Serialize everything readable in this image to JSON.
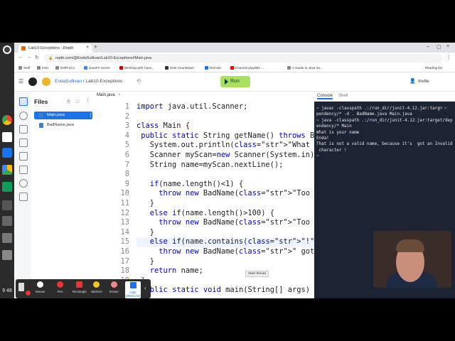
{
  "browser": {
    "tab_title": "Lab10-Exceptions - Replit",
    "url": "replit.com/@EndaSullivan/Lab10-Exceptions#Main.java",
    "bookmarks": [
      "Stuff",
      "KSU",
      "DefProCo",
      "JavaFX Scene",
      "Working with Canv...",
      "Dots Countdown",
      "Remote",
      "Channel playlists -...",
      "A Guide to Java So..."
    ],
    "reading_list": "Reading list"
  },
  "replit": {
    "user": "EndaSullivan",
    "repl": "Lab10-Exceptions",
    "run_label": "Run",
    "invite_label": "Invite"
  },
  "files": {
    "title": "Files",
    "items": [
      "Main.java",
      "BadName.java"
    ]
  },
  "editor": {
    "tab": "Main.java",
    "tooltip": "Start thread",
    "lines": [
      {
        "n": "1",
        "code": "import java.util.Scanner;"
      },
      {
        "n": "2",
        "code": ""
      },
      {
        "n": "3",
        "code": "class Main {"
      },
      {
        "n": "4",
        "code": " public static String getName() throws Ba"
      },
      {
        "n": "5",
        "code": "   System.out.println(\"What is your name"
      },
      {
        "n": "6",
        "code": "   Scanner myScan=new Scanner(System.in)"
      },
      {
        "n": "7",
        "code": "   String name=myScan.nextLine();"
      },
      {
        "n": "8",
        "code": ""
      },
      {
        "n": "9",
        "code": "   if(name.length()<1) {"
      },
      {
        "n": "10",
        "code": "     throw new BadName(\"Too Short\");"
      },
      {
        "n": "11",
        "code": "   }"
      },
      {
        "n": "12",
        "code": "   else if(name.length()>100) {"
      },
      {
        "n": "13",
        "code": "     throw new BadName(\"Too Long\");"
      },
      {
        "n": "14",
        "code": "   }"
      },
      {
        "n": "15",
        "code": "   else if(name.contains(\"!\")) {"
      },
      {
        "n": "16",
        "code": "     throw new BadName(\" got an Invalid"
      },
      {
        "n": "17",
        "code": "   }"
      },
      {
        "n": "18",
        "code": "   return name;"
      },
      {
        "n": "19",
        "code": " }"
      },
      {
        "n": "20",
        "code": " public static void main(String[] args)"
      }
    ]
  },
  "console": {
    "tabs": [
      "Console",
      "Shell"
    ],
    "output": "~ javac -classpath .:/run_dir/junit-4.12.jar:targ\npendency/* -d . BadName.java Main.java\n~ java -classpath .:/run_dir/junit-4.12.jar:target/dep\nendency/* Main\nWhat is your name\nEnda!\nThat is not a valid name, because it's  got an Invalid\n character !\n~ "
  },
  "annotation_toolbar": {
    "tools": [
      "Mouse",
      "Pen",
      "Rectangle",
      "Stickers",
      "Eraser",
      "Hide WEBCAM"
    ]
  },
  "shelf": {
    "time": "9\n48"
  },
  "colors": {
    "run": "#a9e05f",
    "accent": "#1a73e8",
    "console_bg": "#1c2333"
  }
}
